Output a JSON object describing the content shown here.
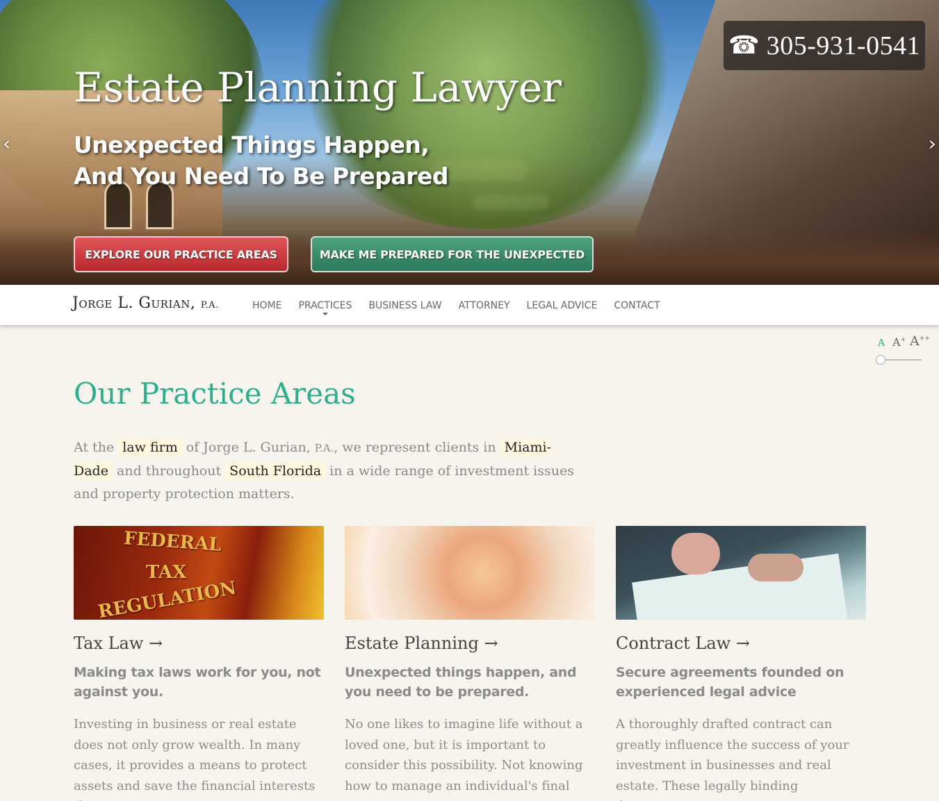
{
  "hero": {
    "phone_icon": "☎",
    "phone": "305-931-0541",
    "title": "Estate Planning Lawyer",
    "subtitle_line1": "Unexpected Things Happen,",
    "subtitle_line2": "And You Need To Be Prepared",
    "prev_arrow": "‹",
    "next_arrow": "›",
    "cta_primary": "EXPLORE OUR PRACTICE AREAS",
    "cta_secondary": "MAKE ME PREPARED FOR THE UNEXPECTED"
  },
  "nav": {
    "logo": "Jorge L. Gurian,",
    "logo_suffix": "P.A.",
    "items": [
      "HOME",
      "PRACTICES",
      "BUSINESS LAW",
      "ATTORNEY",
      "LEGAL ADVICE",
      "CONTACT"
    ]
  },
  "font_size_widget": {
    "small": "A",
    "medium": "A",
    "medium_sup": "+",
    "large": "A",
    "large_sup": "++"
  },
  "practice": {
    "title": "Our Practice Areas",
    "intro_1": "At the",
    "intro_hl_1": "law firm",
    "intro_2": "of Jorge L. Gurian,",
    "intro_pa": "P.A.",
    "intro_3": ", we represent clients in",
    "intro_hl_2": "Miami-Dade",
    "intro_4": "and throughout",
    "intro_hl_3": "South Florida",
    "intro_5": "in a wide range of investment issues and property protection matters.",
    "cards": [
      {
        "title": "Tax Law →",
        "img_text_1": "FEDERAL",
        "img_text_2": "TAX",
        "img_text_3": "REGULATION",
        "subtitle": "Making tax laws work for you, not against you.",
        "body": "Investing in business or real estate does not only grow wealth. In many cases, it provides a means to protect assets and save the financial interests that a"
      },
      {
        "title": "Estate Planning →",
        "subtitle": "Unexpected things happen, and you need to be prepared.",
        "body": "No one likes to imagine life without a loved one, but it is important to consider this possibility. Not knowing how to manage an individual's final"
      },
      {
        "title": "Contract Law →",
        "subtitle": "Secure agreements founded on experienced legal advice",
        "body": "A thoroughly drafted contract can greatly influence the success of your investment in businesses and real estate. These legally binding documents"
      }
    ]
  }
}
